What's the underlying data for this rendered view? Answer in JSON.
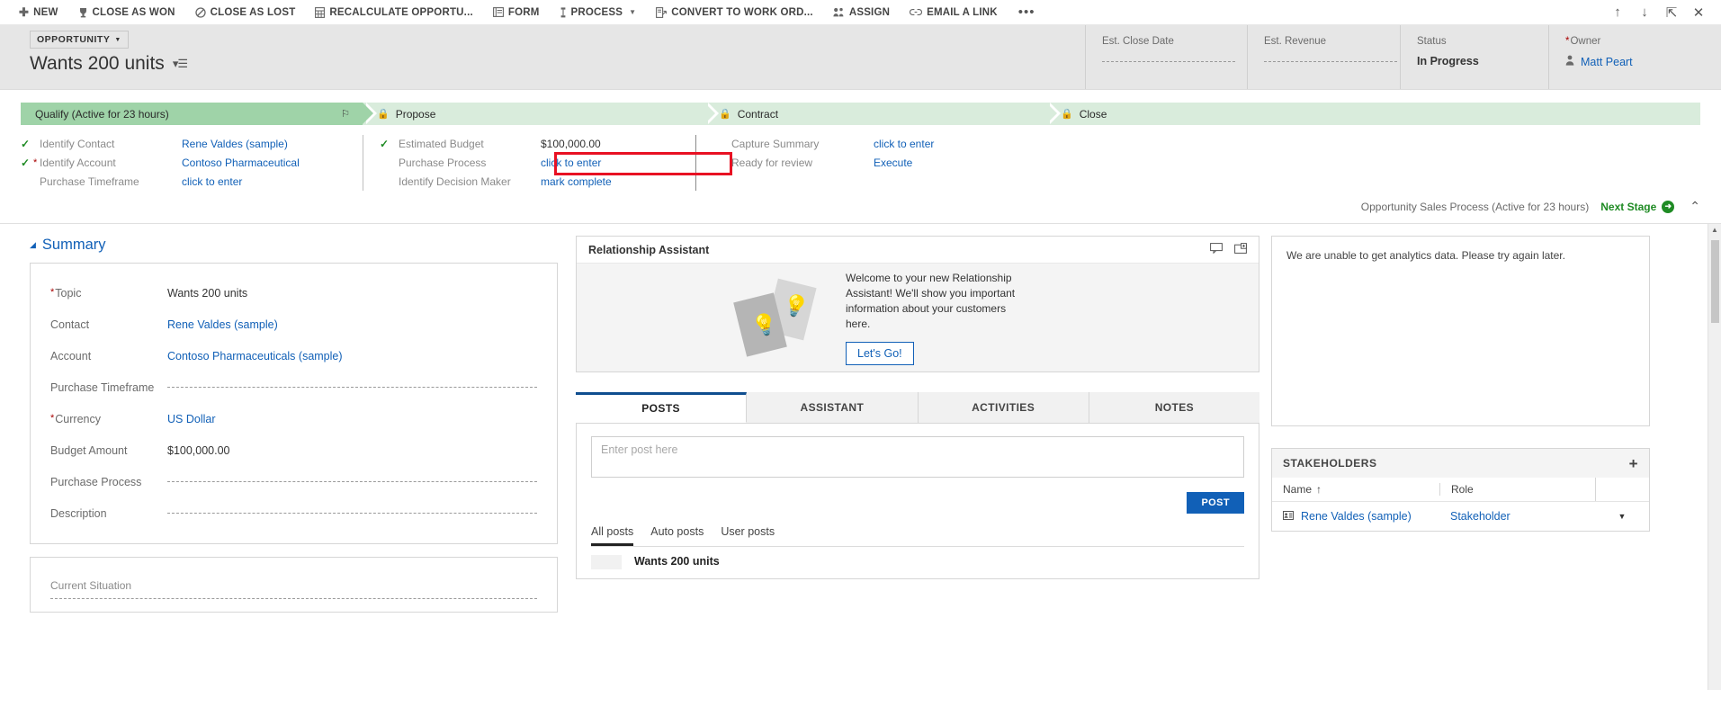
{
  "commandbar": {
    "items": [
      {
        "label": "NEW",
        "icon": "plus-icon",
        "glyph": "✚",
        "caret": false
      },
      {
        "label": "CLOSE AS WON",
        "icon": "trophy-icon",
        "glyph": "♗",
        "caret": false
      },
      {
        "label": "CLOSE AS LOST",
        "icon": "prohibited-icon",
        "glyph": "🚫",
        "caret": false
      },
      {
        "label": "RECALCULATE OPPORTU...",
        "icon": "calculator-icon",
        "glyph": "▦",
        "caret": false
      },
      {
        "label": "FORM",
        "icon": "form-icon",
        "glyph": "▤",
        "caret": false
      },
      {
        "label": "PROCESS",
        "icon": "process-icon",
        "glyph": "⋮",
        "caret": true
      },
      {
        "label": "CONVERT TO WORK ORD...",
        "icon": "convert-icon",
        "glyph": "🗒",
        "caret": false
      },
      {
        "label": "ASSIGN",
        "icon": "assign-icon",
        "glyph": "👥",
        "caret": false
      },
      {
        "label": "EMAIL A LINK",
        "icon": "link-icon",
        "glyph": "⛓",
        "caret": false
      }
    ],
    "overflow_label": "•••",
    "right_icons": [
      {
        "name": "previous-record-icon",
        "glyph": "↑"
      },
      {
        "name": "next-record-icon",
        "glyph": "↓"
      },
      {
        "name": "popout-icon",
        "glyph": "⇱"
      },
      {
        "name": "close-icon",
        "glyph": "✕"
      }
    ]
  },
  "record_header": {
    "entity_chip": "OPPORTUNITY",
    "title": "Wants 200 units",
    "fields": [
      {
        "label": "Est. Close Date",
        "value": "",
        "required": false,
        "empty": true
      },
      {
        "label": "Est. Revenue",
        "value": "",
        "required": false,
        "empty": true
      },
      {
        "label": "Status",
        "value": "In Progress",
        "required": false,
        "empty": false
      },
      {
        "label": "Owner",
        "value": "Matt Peart",
        "required": true,
        "empty": false,
        "is_link": true
      }
    ]
  },
  "process": {
    "stages": [
      {
        "label": "Qualify (Active for 23 hours)",
        "active": true,
        "locked": false
      },
      {
        "label": "Propose",
        "active": false,
        "locked": true
      },
      {
        "label": "Contract",
        "active": false,
        "locked": true
      },
      {
        "label": "Close",
        "active": false,
        "locked": true
      }
    ],
    "columns": [
      {
        "steps": [
          {
            "name": "Identify Contact",
            "value": "Rene Valdes (sample)",
            "complete": true,
            "required": false,
            "link": true
          },
          {
            "name": "Identify Account",
            "value": "Contoso Pharmaceutical",
            "complete": true,
            "required": true,
            "link": true
          },
          {
            "name": "Purchase Timeframe",
            "value": "click to enter",
            "complete": false,
            "required": false,
            "link": true
          }
        ]
      },
      {
        "steps": [
          {
            "name": "Estimated Budget",
            "value": "$100,000.00",
            "complete": true,
            "required": false,
            "link": false
          },
          {
            "name": "Purchase Process",
            "value": "click to enter",
            "complete": false,
            "required": false,
            "link": true
          },
          {
            "name": "Identify Decision Maker",
            "value": "mark complete",
            "complete": false,
            "required": false,
            "link": true
          }
        ]
      },
      {
        "steps": [
          {
            "name": "Capture Summary",
            "value": "click to enter",
            "complete": false,
            "required": false,
            "link": true
          },
          {
            "name": "Ready for review",
            "value": "Execute",
            "complete": false,
            "required": false,
            "link": true
          }
        ]
      }
    ],
    "footer_text": "Opportunity Sales Process (Active for 23 hours)",
    "next_stage_label": "Next Stage",
    "highlight_color": "#e81123"
  },
  "summary": {
    "section_title": "Summary",
    "fields": [
      {
        "label": "Topic",
        "value": "Wants 200 units",
        "required": true,
        "empty": false,
        "link": false
      },
      {
        "label": "Contact",
        "value": "Rene Valdes (sample)",
        "required": false,
        "empty": false,
        "link": true
      },
      {
        "label": "Account",
        "value": "Contoso Pharmaceuticals (sample)",
        "required": false,
        "empty": false,
        "link": true
      },
      {
        "label": "Purchase Timeframe",
        "value": "",
        "required": false,
        "empty": true,
        "link": false
      },
      {
        "label": "Currency",
        "value": "US Dollar",
        "required": true,
        "empty": false,
        "link": true
      },
      {
        "label": "Budget Amount",
        "value": "$100,000.00",
        "required": false,
        "empty": false,
        "link": false
      },
      {
        "label": "Purchase Process",
        "value": "",
        "required": false,
        "empty": true,
        "link": false
      },
      {
        "label": "Description",
        "value": "",
        "required": false,
        "empty": true,
        "link": false
      }
    ],
    "current_situation_label": "Current Situation"
  },
  "relationship_assistant": {
    "title": "Relationship Assistant",
    "welcome_text": "Welcome to your new Relationship Assistant! We'll show you important information about your customers here.",
    "button_label": "Let's Go!",
    "header_icons": [
      {
        "name": "comment-icon",
        "glyph": "🗩"
      },
      {
        "name": "add-card-icon",
        "glyph": "🗇"
      }
    ]
  },
  "social_pane": {
    "tabs": [
      {
        "label": "POSTS",
        "active": true
      },
      {
        "label": "ASSISTANT",
        "active": false
      },
      {
        "label": "ACTIVITIES",
        "active": false
      },
      {
        "label": "NOTES",
        "active": false
      }
    ],
    "post_placeholder": "Enter post here",
    "post_button": "POST",
    "filters": [
      {
        "label": "All posts",
        "active": true
      },
      {
        "label": "Auto posts",
        "active": false
      },
      {
        "label": "User posts",
        "active": false
      }
    ],
    "feed": [
      {
        "title": "Wants 200 units"
      }
    ]
  },
  "analytics": {
    "message": "We are unable to get analytics data. Please try again later."
  },
  "stakeholders": {
    "title": "STAKEHOLDERS",
    "columns": [
      "Name",
      "Role",
      ""
    ],
    "sort_glyph": "↑",
    "rows": [
      {
        "name": "Rene Valdes (sample)",
        "role": "Stakeholder"
      }
    ]
  }
}
